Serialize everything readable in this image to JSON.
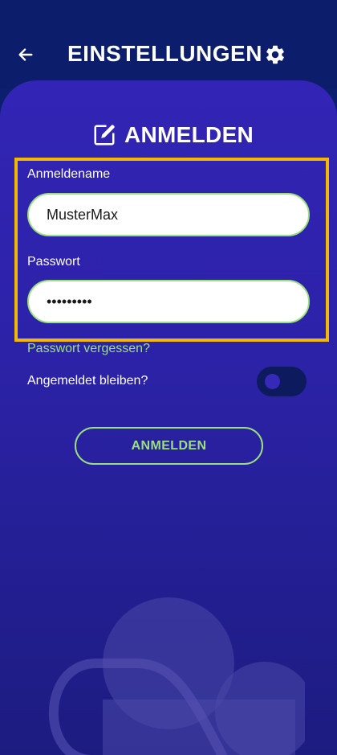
{
  "header": {
    "title": "EINSTELLUNGEN",
    "back_icon": "arrow-left-icon",
    "settings_icon": "gear-icon"
  },
  "login_section": {
    "title": "ANMELDEN",
    "icon": "edit-icon"
  },
  "form": {
    "username_label": "Anmeldename",
    "username_value": "MusterMax",
    "password_label": "Passwort",
    "password_value": "•••••••••",
    "forgot_password": "Passwort vergessen?",
    "remember_label": "Angemeldet bleiben?",
    "remember_enabled": false,
    "submit_label": "ANMELDEN"
  },
  "colors": {
    "background": "#0b1d6b",
    "panel": "#3224b5",
    "accent_green": "#9be07e",
    "highlight": "#f5b800"
  }
}
